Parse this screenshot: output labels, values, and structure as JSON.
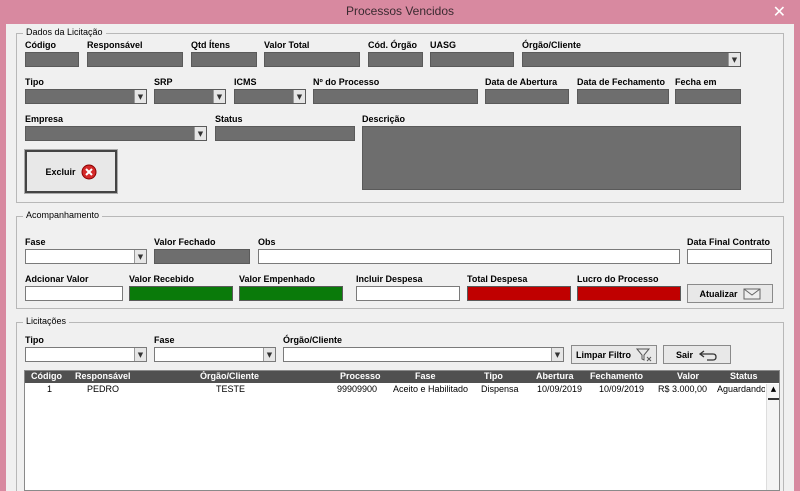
{
  "window": {
    "title": "Processos Vencidos",
    "close_glyph": "✕"
  },
  "dados": {
    "frame_title": "Dados da Licitação",
    "labels": {
      "codigo": "Código",
      "responsavel": "Responsável",
      "qtd_itens": "Qtd Ítens",
      "valor_total": "Valor Total",
      "cod_orgao": "Cód. Órgão",
      "uasg": "UASG",
      "orgao_cliente": "Órgão/Cliente",
      "tipo": "Tipo",
      "srp": "SRP",
      "icms": "ICMS",
      "num_processo": "Nº do Processo",
      "data_abertura": "Data de Abertura",
      "data_fechamento": "Data de Fechamento",
      "fecha_em": "Fecha em",
      "empresa": "Empresa",
      "status": "Status",
      "descricao": "Descrição"
    },
    "excluir_label": "Excluir"
  },
  "acompanhamento": {
    "frame_title": "Acompanhamento",
    "labels": {
      "fase": "Fase",
      "valor_fechado": "Valor Fechado",
      "obs": "Obs",
      "data_final_contrato": "Data Final Contrato",
      "adicionar_valor": "Adcionar Valor",
      "valor_recebido": "Valor Recebido",
      "valor_empenhado": "Valor Empenhado",
      "incluir_despesa": "Incluir Despesa",
      "total_despesa": "Total Despesa",
      "lucro_processo": "Lucro do Processo"
    },
    "atualizar_label": "Atualizar"
  },
  "licitacoes": {
    "frame_title": "Licitações",
    "labels": {
      "tipo": "Tipo",
      "fase": "Fase",
      "orgao_cliente": "Órgão/Cliente"
    },
    "limpar_filtro_label": "Limpar Filtro",
    "sair_label": "Sair",
    "columns": [
      "Código",
      "Responsável",
      "Órgão/Cliente",
      "Processo",
      "Fase",
      "Tipo",
      "Abertura",
      "Fechamento",
      "Valor",
      "Status"
    ],
    "rows": [
      [
        "1",
        "PEDRO",
        "TESTE",
        "99909900",
        "Aceito e Habilitado",
        "Dispensa",
        "10/09/2019",
        "10/09/2019",
        "R$ 3.000,00",
        "Aguardando"
      ]
    ]
  },
  "colors": {
    "field_gray": "#6e6e6e",
    "green": "#0a7a0a",
    "red": "#c00000",
    "title_bar": "#d889a0"
  }
}
